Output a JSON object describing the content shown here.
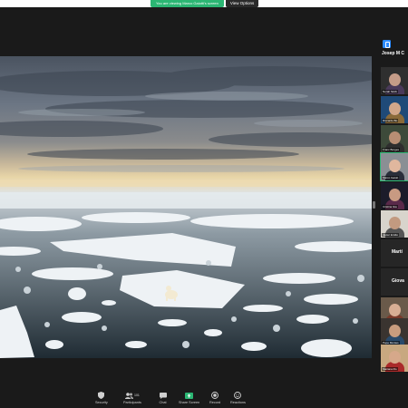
{
  "banner": {
    "sharing_text": "You are viewing Marco Gaiotti's screen",
    "view_options": "View Options"
  },
  "gallery": {
    "title": "Josep M C",
    "tiles": [
      {
        "name": "Norah Sinth"
      },
      {
        "name": "Riccardo Bo"
      },
      {
        "name": "Franc Borges"
      },
      {
        "name": "Marco Gaiott"
      },
      {
        "name": "Cristina Gia"
      },
      {
        "name": "Javier Emilio"
      },
      {
        "name": "Martí",
        "text_only": true
      },
      {
        "name": "Giova",
        "text_only": true
      },
      {
        "name": "Mirella"
      },
      {
        "name": "Pepe Montes"
      },
      {
        "name": "Mariana Ro"
      }
    ]
  },
  "toolbar": {
    "security": "Security",
    "participants": "Participants",
    "participants_count": "101",
    "chat": "Chat",
    "share_screen": "Share Screen",
    "record": "Record",
    "reactions": "Reactions",
    "accent": "#2bb673"
  },
  "colors": {
    "zoom_blue": "#2d8cff",
    "share_green": "#2bb673"
  }
}
